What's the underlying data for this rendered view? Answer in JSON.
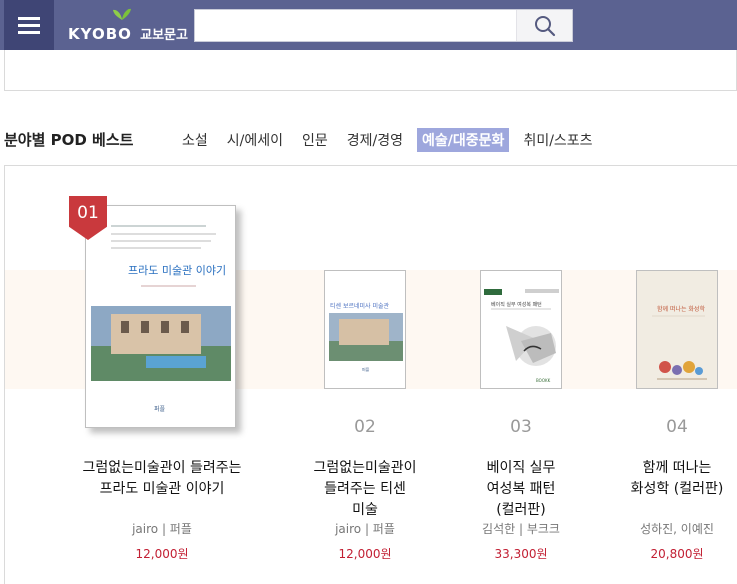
{
  "header": {
    "logo_text": "KYOBO",
    "logo_text_ko": "교보문고",
    "search_value": ""
  },
  "category": {
    "title": "분야별 POD 베스트",
    "tabs": [
      {
        "label": "소설",
        "active": false
      },
      {
        "label": "시/에세이",
        "active": false
      },
      {
        "label": "인문",
        "active": false
      },
      {
        "label": "경제/경영",
        "active": false
      },
      {
        "label": "예술/대중문화",
        "active": true
      },
      {
        "label": "취미/스포츠",
        "active": false
      }
    ]
  },
  "books": [
    {
      "rank": "01",
      "title": "그럼없는미술관이 들려주는 프라도 미술관 이야기",
      "author": "jairo | 퍼플",
      "price": "12,000원",
      "cover_text": "프라도 미술관 이야기",
      "cover_publisher": "퍼플"
    },
    {
      "rank": "02",
      "title": "그럼없는미술관이 들려주는 티센 미술",
      "author": "jairo | 퍼플",
      "price": "12,000원",
      "cover_text": "티센 보르네미사 미술관",
      "cover_publisher": "퍼플"
    },
    {
      "rank": "03",
      "title": "베이직 실무 여성복 패턴 (컬러판)",
      "author": "김석한 | 부크크",
      "price": "33,300원",
      "cover_text": "베이직 실무 여성복 패턴",
      "cover_publisher": "BOOKK"
    },
    {
      "rank": "04",
      "title": "함께 떠나는 화성학 (컬러판)",
      "author": "성하진, 이예진",
      "price": "20,800원",
      "cover_text": "함께 떠나는 화성학"
    }
  ],
  "colors": {
    "header_bg": "#5b6291",
    "menu_bg": "#3f4575",
    "active_tab_bg": "#9ea7dd",
    "rank_flag": "#c9393d",
    "price": "#c21f33",
    "band": "#fef8f2",
    "logo_leaf": "#8fce4a"
  }
}
